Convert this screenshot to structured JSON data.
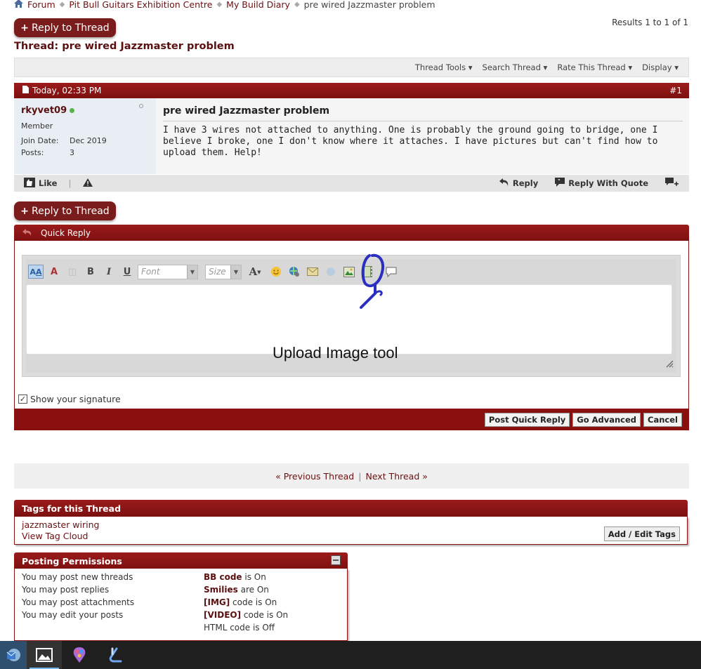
{
  "breadcrumb": {
    "items": [
      "Forum",
      "Pit Bull Guitars Exhibition Centre",
      "My Build Diary"
    ],
    "current": "pre wired Jazzmaster problem"
  },
  "reply_button": {
    "label": "Reply to Thread",
    "plus": "+"
  },
  "results": "Results 1 to 1 of 1",
  "thread": {
    "title": "Thread: pre wired Jazzmaster problem"
  },
  "thread_tools": {
    "items": [
      "Thread Tools",
      "Search Thread",
      "Rate This Thread",
      "Display"
    ]
  },
  "post": {
    "date": "Today, 02:33 PM",
    "number": "#1",
    "username": "rkyvet09",
    "user_title": "Member",
    "join_label": "Join Date:",
    "join_value": "Dec 2019",
    "posts_label": "Posts:",
    "posts_value": "3",
    "title": "pre wired Jazzmaster problem",
    "text": "I have 3 wires not attached to anything. One is probably the ground going to bridge, one I believe I broke, one I don't know where it attaches. I have pictures but can't find how to upload them. Help!",
    "like_label": "Like",
    "reply_label": "Reply",
    "reply_quote_label": "Reply With Quote"
  },
  "quick_reply": {
    "title": "Quick Reply",
    "font_placeholder": "Font",
    "size_placeholder": "Size",
    "annotation": "Upload Image tool",
    "show_signature": "Show your signature",
    "post_button": "Post Quick Reply",
    "advanced_button": "Go Advanced",
    "cancel_button": "Cancel"
  },
  "thread_nav": {
    "prev": "« Previous Thread",
    "sep": "|",
    "next": "Next Thread »"
  },
  "tags": {
    "title": "Tags for this Thread",
    "items": [
      "jazzmaster wiring"
    ],
    "cloud": "View Tag Cloud",
    "edit_button": "Add / Edit Tags"
  },
  "permissions": {
    "title": "Posting Permissions",
    "left": [
      "You may post new threads",
      "You may post replies",
      "You may post attachments",
      "You may edit your posts"
    ],
    "right": [
      {
        "bold": "BB code",
        "rest": " is On"
      },
      {
        "bold": "Smilies",
        "rest": " are On"
      },
      {
        "bold": "[IMG]",
        "rest": " code is On"
      },
      {
        "bold": "[VIDEO]",
        "rest": " code is On"
      },
      {
        "bold": "",
        "rest": "HTML code is Off"
      }
    ]
  },
  "taskbar": {
    "icons": [
      "mail-app-icon",
      "photos-app-icon",
      "paint-app-icon",
      "snip-app-icon"
    ]
  },
  "colors": {
    "accent": "#8a0f0f",
    "link": "#6b1010",
    "annotation_ink": "#2a2fc0"
  }
}
